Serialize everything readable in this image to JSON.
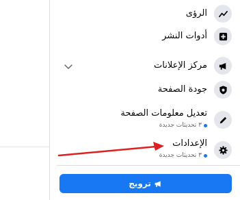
{
  "menu": {
    "items": [
      {
        "label": "الرؤى",
        "icon": "insights-icon"
      },
      {
        "label": "أدوات النشر",
        "icon": "publishing-tools-icon"
      },
      {
        "label": "مركز الإعلانات",
        "icon": "megaphone-icon",
        "expandable": true
      },
      {
        "label": "جودة الصفحة",
        "icon": "shield-icon"
      },
      {
        "label": "تعديل معلومات الصفحة",
        "icon": "pencil-icon",
        "sub": "٣ تحديثات جديدة"
      },
      {
        "label": "الإعدادات",
        "icon": "gear-icon",
        "sub": "٣ تحديثات جديدة"
      }
    ]
  },
  "promote": {
    "label": "ترويج",
    "icon": "megaphone-icon"
  },
  "colors": {
    "accent": "#1877f2",
    "annotation_arrow": "#e02020",
    "icon_bg": "#e4e6eb"
  }
}
